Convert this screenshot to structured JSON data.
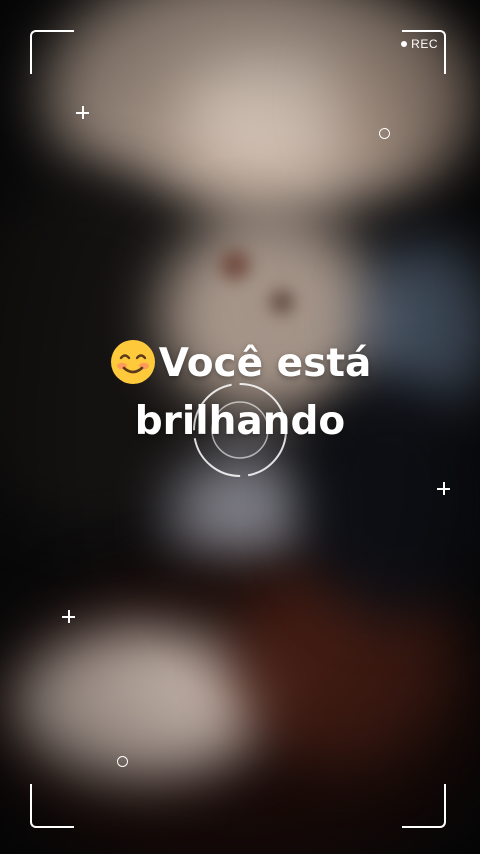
{
  "recorder": {
    "rec_label": "REC"
  },
  "caption": {
    "emoji_icon": "smiling-face-icon",
    "line1": "Você está",
    "line2": "brilhando"
  },
  "colors": {
    "overlay": "#ffffff",
    "emoji_face": "#ffc93c",
    "emoji_blush": "#ff8a65"
  }
}
